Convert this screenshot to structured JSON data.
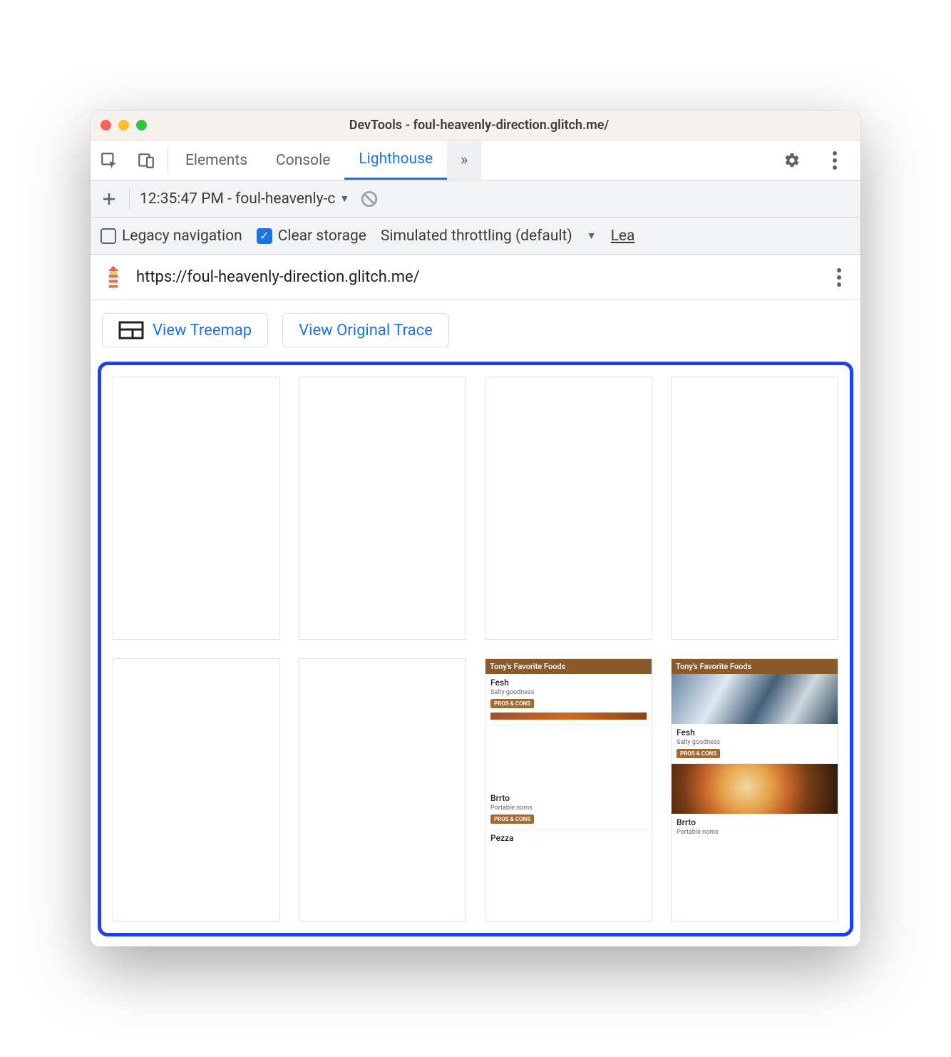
{
  "window": {
    "title": "DevTools - foul-heavenly-direction.glitch.me/"
  },
  "tabs": {
    "items": [
      {
        "label": "Elements",
        "active": false
      },
      {
        "label": "Console",
        "active": false
      },
      {
        "label": "Lighthouse",
        "active": true
      }
    ]
  },
  "reportBar": {
    "selected": "12:35:47 PM - foul-heavenly-c"
  },
  "options": {
    "legacy": {
      "label": "Legacy navigation",
      "checked": false
    },
    "clear": {
      "label": "Clear storage",
      "checked": true
    },
    "throttling": {
      "label": "Simulated throttling (default)"
    },
    "learn": {
      "label": "Lea"
    }
  },
  "url": {
    "value": "https://foul-heavenly-direction.glitch.me/"
  },
  "actions": {
    "treemap": "View Treemap",
    "trace": "View Original Trace"
  },
  "filmstrip": {
    "header": "Tony's Favorite Foods",
    "cards": [
      {
        "title": "Fesh",
        "sub": "Salty goodness",
        "btn": "PROS & CONS"
      },
      {
        "title": "Brrto",
        "sub": "Portable noms",
        "btn": "PROS & CONS"
      },
      {
        "title": "Pezza",
        "sub": "",
        "btn": ""
      }
    ]
  }
}
